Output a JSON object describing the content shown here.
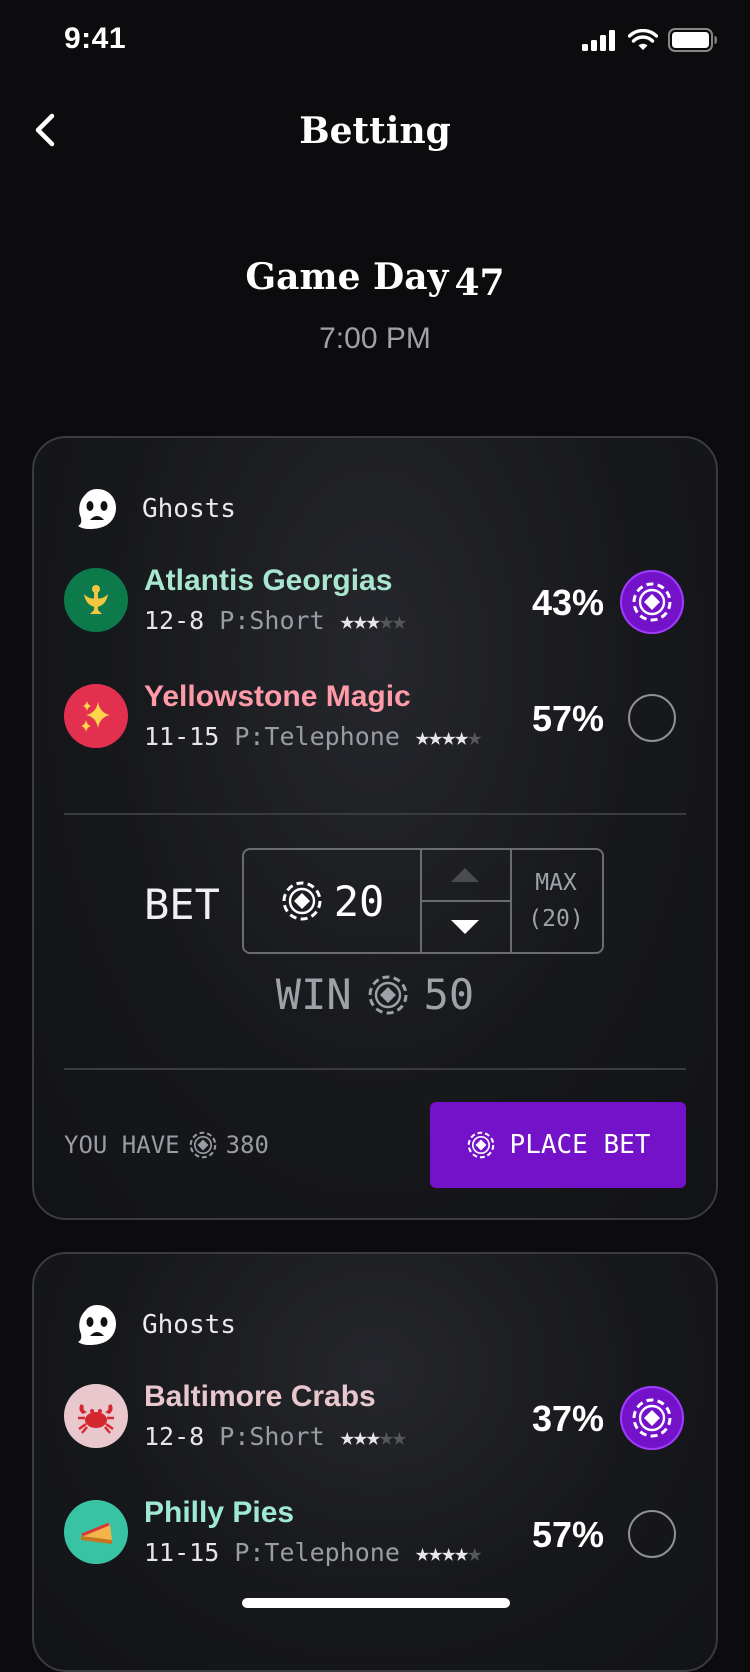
{
  "status": {
    "time": "9:41"
  },
  "nav": {
    "title": "Betting"
  },
  "header": {
    "title": "Game Day",
    "day": "47",
    "time": "7:00 PM"
  },
  "colors": {
    "accent": "#7312c9",
    "team1": "#a8e6cf",
    "team2": "#ff9aa8",
    "team3": "#e8c8cc",
    "team4": "#9fe8d6"
  },
  "cards": [
    {
      "group": "Ghosts",
      "teams": [
        {
          "name": "Atlantis Georgias",
          "record": "12-8",
          "pitcher": "P:Short",
          "stars_filled": "★★★",
          "stars_empty": "★★",
          "pct": "43%",
          "selected": true,
          "icon": "trident-icon"
        },
        {
          "name": "Yellowstone Magic",
          "record": "11-15",
          "pitcher": "P:Telephone",
          "stars_filled": "★★★★",
          "stars_empty": "★",
          "pct": "57%",
          "selected": false,
          "icon": "sparkle-icon"
        }
      ],
      "bet": {
        "label": "BET",
        "amount": "20",
        "max_label": "MAX",
        "max_value": "(20)"
      },
      "win": {
        "label": "WIN",
        "amount": "50"
      },
      "balance": {
        "label": "YOU HAVE",
        "amount": "380"
      },
      "place_bet": "PLACE BET"
    },
    {
      "group": "Ghosts",
      "teams": [
        {
          "name": "Baltimore Crabs",
          "record": "12-8",
          "pitcher": "P:Short",
          "stars_filled": "★★★",
          "stars_empty": "★★",
          "pct": "37%",
          "selected": true,
          "icon": "crab-icon"
        },
        {
          "name": "Philly Pies",
          "record": "11-15",
          "pitcher": "P:Telephone",
          "stars_filled": "★★★★",
          "stars_empty": "★",
          "pct": "57%",
          "selected": false,
          "icon": "pie-icon"
        }
      ]
    }
  ]
}
